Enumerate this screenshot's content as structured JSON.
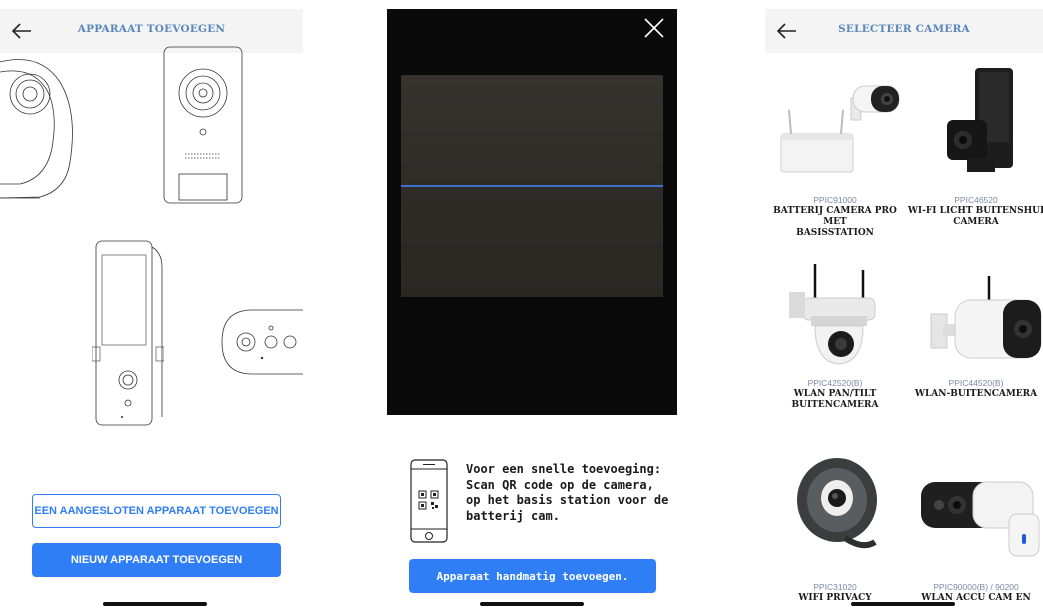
{
  "screen1": {
    "title": "APPARAAT TOEVOEGEN",
    "connected_button": "EEN AANGESLOTEN APPARAAT TOEVOEGEN",
    "new_button": "NIEUW APPARAAT TOEVOEGEN"
  },
  "screen2": {
    "hint_lines": [
      "Voor een snelle toevoeging:",
      "Scan QR code op de camera,",
      "op het basis station voor de",
      "batterij cam."
    ],
    "manual_button": "Apparaat handmatig toevoegen."
  },
  "screen3": {
    "title": "SELECTEER CAMERA",
    "cameras": [
      {
        "code": "PPIC91000",
        "name_lines": [
          "BATTERIJ CAMERA PRO MET",
          "BASISSTATION"
        ]
      },
      {
        "code": "PPIC46520",
        "name_lines": [
          "WI-FI LICHT BUITENSHUI",
          "CAMERA"
        ]
      },
      {
        "code": "PPIC42520(B)",
        "name_lines": [
          "WLAN PAN/TILT",
          "BUITENCAMERA"
        ]
      },
      {
        "code": "PPIC44520(B)",
        "name_lines": [
          "WLAN-BUITENCAMERA",
          ""
        ]
      },
      {
        "code": "PPIC31020",
        "name_lines": [
          "WIFI PRIVACY",
          ""
        ]
      },
      {
        "code": "PPIC90000(B) / 90200",
        "name_lines": [
          "WLAN ACCU CAM EN",
          ""
        ]
      }
    ]
  },
  "colors": {
    "accent": "#2f7ef6",
    "title": "#5b87b8",
    "header_bg": "#f4f4f5"
  }
}
